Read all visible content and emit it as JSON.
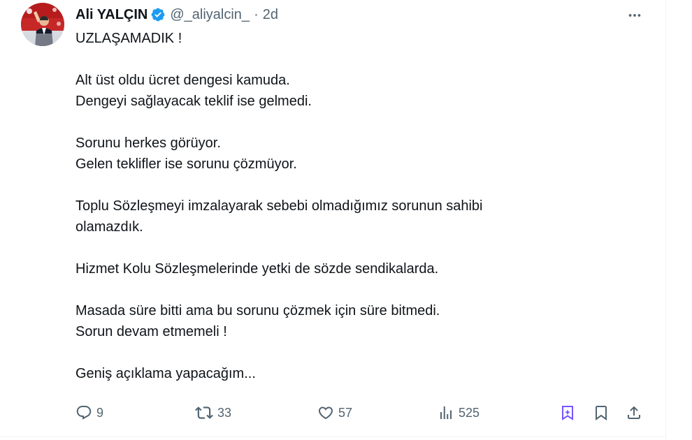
{
  "tweet": {
    "author": {
      "display_name": "Ali YALÇIN",
      "handle": "@_aliyalcin_",
      "separator": "·",
      "time": "2d",
      "verified": true
    },
    "body": {
      "line_1": "UZLAŞAMADIK !",
      "para_2_line_1": "Alt üst oldu ücret dengesi kamuda.",
      "para_2_line_2": "Dengeyi sağlayacak teklif ise gelmedi.",
      "para_3_line_1": "Sorunu herkes görüyor.",
      "para_3_line_2": "Gelen teklifler ise sorunu çözmüyor.",
      "para_4_line_1": "Toplu Sözleşmeyi imzalayarak sebebi olmadığımız sorunun sahibi",
      "para_4_line_2": "olamazdık.",
      "para_5_line_1": "Hizmet Kolu Sözleşmelerinde yetki de sözde sendikalarda.",
      "para_6_line_1": "Masada süre bitti ama bu sorunu çözmek için süre bitmedi.",
      "para_6_line_2": "Sorun devam etmemeli !",
      "para_7_line_1": "Geniş açıklama yapacağım..."
    },
    "actions": {
      "replies": "9",
      "reposts": "33",
      "likes": "57",
      "views": "525"
    }
  },
  "icons": {
    "more": "more-dots-icon",
    "reply": "reply-bubble-icon",
    "repost": "repost-arrows-icon",
    "like": "heart-icon",
    "views": "views-bars-icon",
    "grok": "grok-icon",
    "bookmark": "bookmark-icon",
    "share": "share-icon"
  },
  "colors": {
    "text": "#0f1419",
    "secondary": "#536471",
    "verified": "#1d9bf0",
    "grok_accent": "#7856ff",
    "border": "#eff3f4"
  }
}
